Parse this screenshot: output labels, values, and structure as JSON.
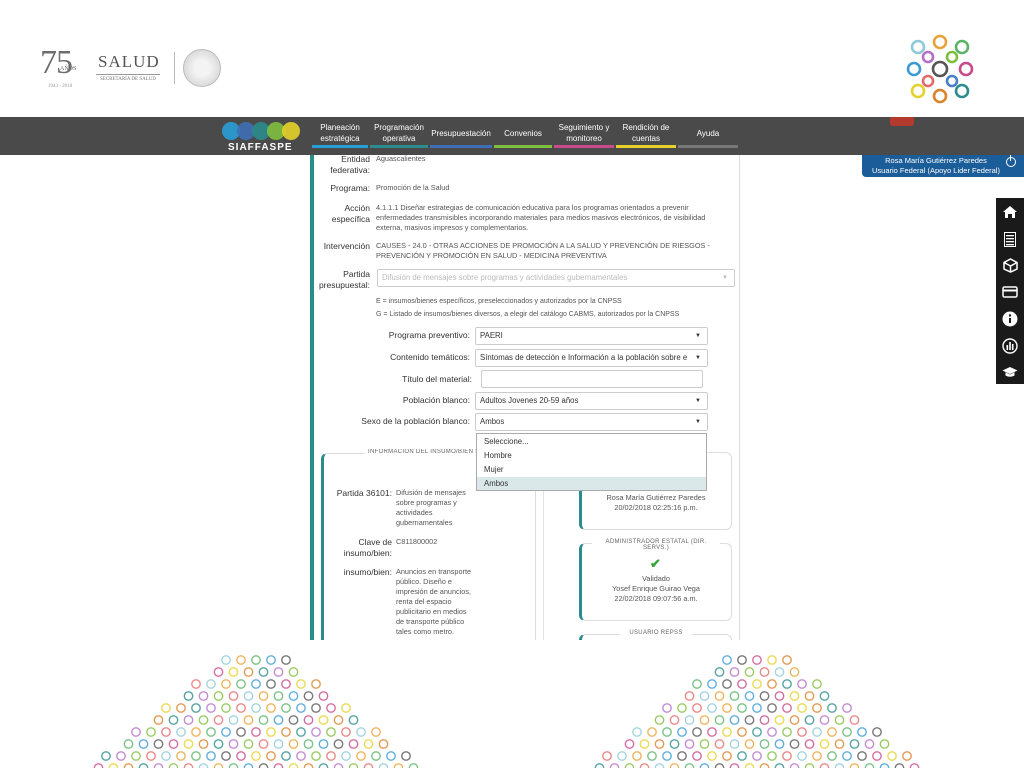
{
  "branding": {
    "logo_75": "75",
    "logo_75_sub": "AÑOS",
    "logo_75_years": "1943 - 2018",
    "salud": "SALUD",
    "salud_sub": "SECRETARÍA DE SALUD"
  },
  "nav": {
    "logo": "SIAFFASPE",
    "items": [
      {
        "label": "Planeación estratégica",
        "color": "#2a9fd6"
      },
      {
        "label": "Programación operativa",
        "color": "#2a8c8c"
      },
      {
        "label": "Presupuestación",
        "color": "#3f6fb5"
      },
      {
        "label": "Convenios",
        "color": "#7fbf3f"
      },
      {
        "label": "Seguimiento y monitoreo",
        "color": "#c94a8a"
      },
      {
        "label": "Rendición de cuentas",
        "color": "#e5d12a"
      },
      {
        "label": "Ayuda",
        "color": "#777777"
      }
    ]
  },
  "user": {
    "name": "Rosa María Gutiérrez Paredes",
    "role": "Usuario Federal (Apoyo Lider Federal)"
  },
  "dock_icons": [
    "home-icon",
    "list-icon",
    "cube-icon",
    "card-icon",
    "info-icon",
    "chart-icon",
    "graduation-icon"
  ],
  "form": {
    "entidad_label": "Entidad federativa:",
    "entidad_value": "Aguascalientes",
    "programa_label": "Programa:",
    "programa_value": "Promoción de la Salud",
    "accion_label": "Acción específica",
    "accion_value": "4.1.1.1 Diseñar estrategias de comunicación educativa para los programas orientados a prevenir enfermedades transmisibles incorporando materiales para medios masivos electrónicos, de visibilidad externa, masivos impresos y complementarios.",
    "intervencion_label": "Intervención",
    "intervencion_value": "CAUSES - 24.0 - OTRAS ACCIONES DE PROMOCIÓN A LA SALUD Y PREVENCIÓN DE RIESGOS - PREVENCIÓN Y PROMOCIÓN EN SALUD - MEDICINA PREVENTIVA",
    "partida_label": "Partida presupuestal:",
    "partida_value": "Difusión de mensajes sobre programas y actividades gubernamentales",
    "note_e": "E = insumos/bienes específicos, preseleccionados y autorizados por la CNPSS",
    "note_g": "G = Listado de insumos/bienes diversos, a elegir del catálogo CABMS, autorizados por la CNPSS",
    "programa_prev_label": "Programa preventivo:",
    "programa_prev_value": "PAERI",
    "contenido_label": "Contenido temáticos:",
    "contenido_value": "Síntomas de detección e Información a la población sobre e",
    "titulo_label": "Título del material:",
    "titulo_value": "",
    "poblacion_label": "Población blanco:",
    "poblacion_value": "Adultos Jovenes 20-59 años",
    "sexo_label": "Sexo de la población blanco:",
    "sexo_value": "Ambos",
    "sexo_options": [
      "Seleccione...",
      "Hombre",
      "Mujer",
      "Ambos"
    ]
  },
  "insumo": {
    "legend": "Información del insumo/bien selecc",
    "partida_label": "Partida 36101:",
    "partida_value": "Difusión de mensajes sobre programas y actividades gubernamentales",
    "clave_label": "Clave de insumo/bien:",
    "clave_value": "C811800002",
    "insumo_label": "insumo/bien:",
    "insumo_value": "Anuncios en transporte público. Diseño e impresión de anuncios, renta del espacio publicitario en medios de transporte público tales como metro."
  },
  "status": {
    "box1_name": "Rosa María Gutiérrez Paredes",
    "box1_date": "20/02/2018 02:25:16 p.m.",
    "box2_title": "Administrador Estatal (Dir. Servs.)",
    "box2_state": "Validado",
    "box2_name": "Yosef Enrique Guirao Vega",
    "box2_date": "22/02/2018 09:07:56 a.m.",
    "box3_title": "Usuario REPSS"
  }
}
